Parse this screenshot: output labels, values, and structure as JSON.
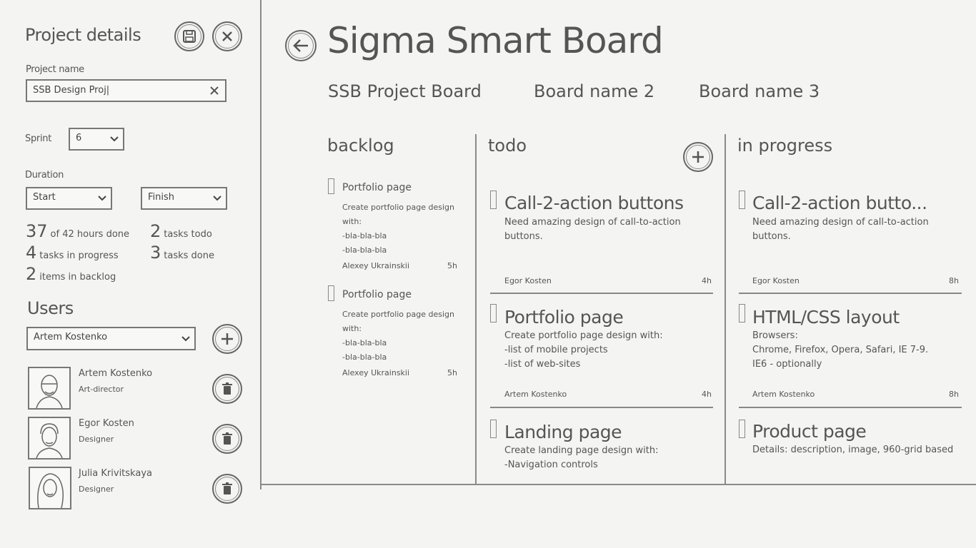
{
  "panel": {
    "title": "Project details",
    "icons": {
      "save": "save-icon",
      "close": "close-icon"
    },
    "project_name_label": "Project name",
    "project_name_value": "SSB Design Proj|",
    "sprint_label": "Sprint",
    "sprint_value": "6",
    "duration_label": "Duration",
    "start_value": "Start",
    "finish_value": "Finish",
    "stats": {
      "hours_num": "37",
      "hours_txt": "of 42 hours done",
      "todo_num": "2",
      "todo_txt": "tasks todo",
      "progress_num": "4",
      "progress_txt": "tasks in progress",
      "done_num": "3",
      "done_txt": "tasks done",
      "backlog_num": "2",
      "backlog_txt": "items in backlog"
    },
    "users_title": "Users",
    "user_select_value": "Artem Kostenko",
    "users": [
      {
        "name": "Artem Kostenko",
        "role": "Art-director"
      },
      {
        "name": "Egor Kosten",
        "role": "Designer"
      },
      {
        "name": "Julia Krivitskaya",
        "role": "Designer"
      }
    ]
  },
  "board": {
    "title": "Sigma Smart Board",
    "tabs": [
      "SSB Project Board",
      "Board name 2",
      "Board name 3"
    ],
    "columns": [
      "backlog",
      "todo",
      "in progress"
    ],
    "backlog": [
      {
        "title": "Portfolio page",
        "desc": "Create portfolio page design\nwith:\n-bla-bla-bla\n-bla-bla-bla",
        "assignee": "Alexey Ukrainskii",
        "hours": "5h"
      },
      {
        "title": "Portfolio page",
        "desc": "Create portfolio page design\nwith:\n-bla-bla-bla\n-bla-bla-bla",
        "assignee": "Alexey Ukrainskii",
        "hours": "5h"
      }
    ],
    "todo": [
      {
        "title": "Call-2-action buttons",
        "desc": "Need amazing design of call-to-action\nbuttons.",
        "assignee": "Egor Kosten",
        "hours": "4h"
      },
      {
        "title": "Portfolio page",
        "desc": "Create portfolio page design with:\n-list of mobile projects\n-list of web-sites",
        "assignee": "Artem Kostenko",
        "hours": "4h"
      },
      {
        "title": "Landing page",
        "desc": "Create landing page design with:\n-Navigation controls",
        "assignee": "",
        "hours": ""
      }
    ],
    "in_progress": [
      {
        "title": "Call-2-action butto...",
        "desc": "Need amazing design of call-to-action\nbuttons.",
        "assignee": "Egor Kosten",
        "hours": "8h"
      },
      {
        "title": "HTML/CSS layout",
        "desc": "Browsers:\nChrome, Firefox, Opera, Safari, IE 7-9.\nIE6 - optionally",
        "assignee": "Artem Kostenko",
        "hours": "8h"
      },
      {
        "title": "Product page",
        "desc": "Details: description, image, 960-grid based",
        "assignee": "",
        "hours": ""
      }
    ]
  }
}
